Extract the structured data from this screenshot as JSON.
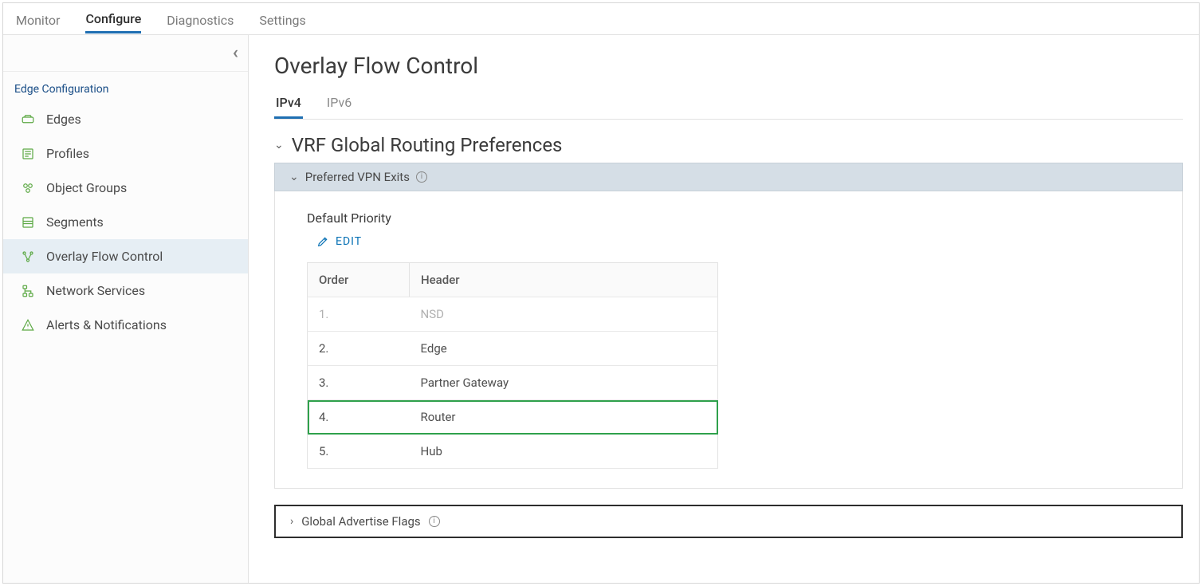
{
  "top_tabs": {
    "monitor": "Monitor",
    "configure": "Configure",
    "diagnostics": "Diagnostics",
    "settings": "Settings"
  },
  "sidebar": {
    "group_title": "Edge Configuration",
    "items": [
      {
        "label": "Edges"
      },
      {
        "label": "Profiles"
      },
      {
        "label": "Object Groups"
      },
      {
        "label": "Segments"
      },
      {
        "label": "Overlay Flow Control"
      },
      {
        "label": "Network Services"
      },
      {
        "label": "Alerts & Notifications"
      }
    ]
  },
  "main": {
    "page_title": "Overlay Flow Control",
    "subtabs": {
      "ipv4": "IPv4",
      "ipv6": "IPv6"
    },
    "section_title": "VRF Global Routing Preferences",
    "vpn_panel_title": "Preferred VPN Exits",
    "default_priority_label": "Default Priority",
    "edit_label": "EDIT",
    "table": {
      "col_order": "Order",
      "col_header": "Header",
      "rows": [
        {
          "order": "1.",
          "header": "NSD"
        },
        {
          "order": "2.",
          "header": "Edge"
        },
        {
          "order": "3.",
          "header": "Partner Gateway"
        },
        {
          "order": "4.",
          "header": "Router"
        },
        {
          "order": "5.",
          "header": "Hub"
        }
      ]
    },
    "flags_panel_title": "Global Advertise Flags"
  }
}
